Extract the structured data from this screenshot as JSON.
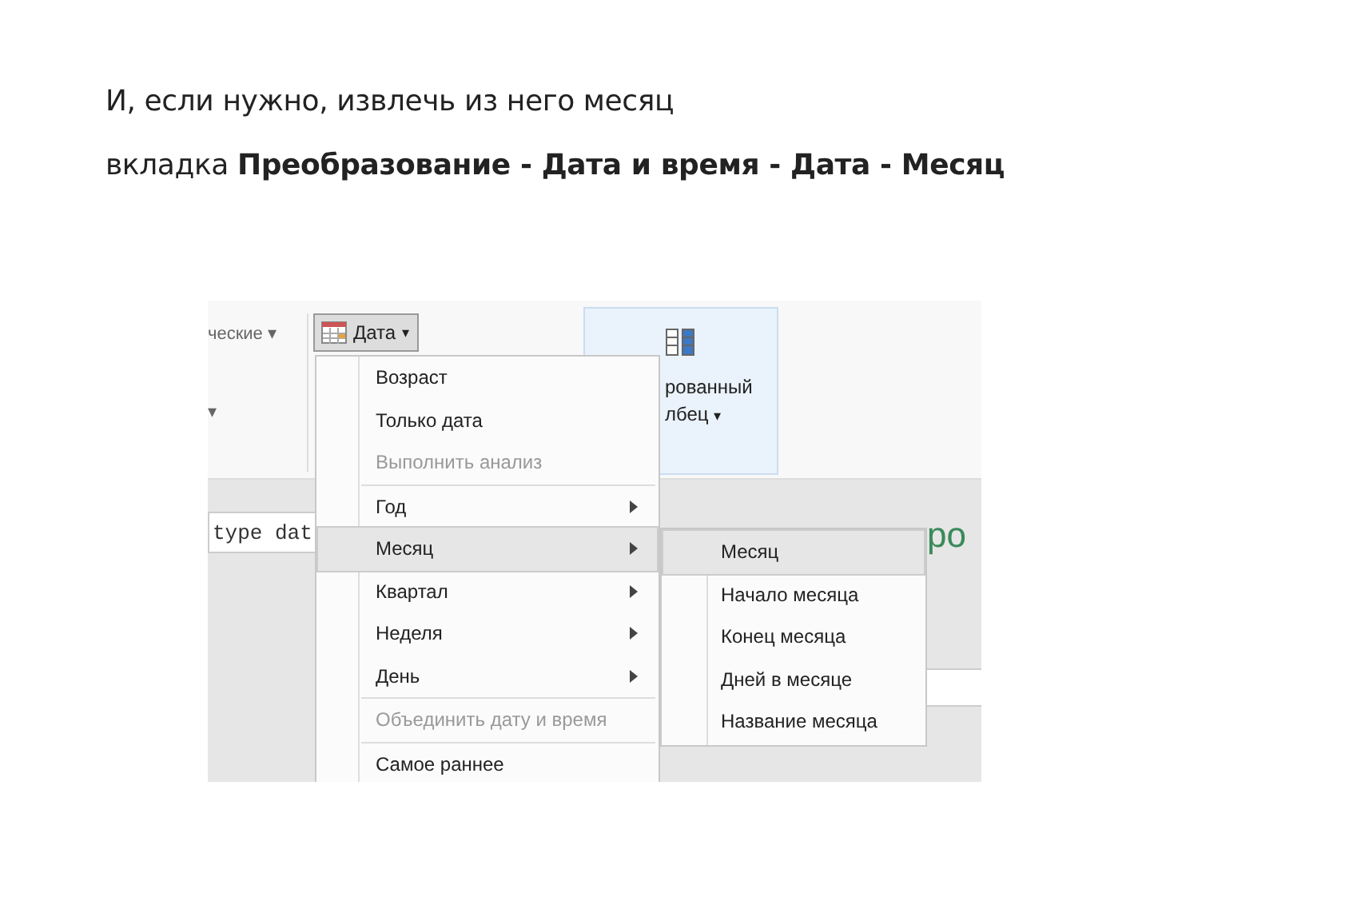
{
  "heading": {
    "line_1": "И, если нужно, извлечь из него месяц",
    "line_2": "вкладка **Преобразование - Дата и время - Дата - Месяц**"
  },
  "screenshot": {
    "ribbon": {
      "group_label": "ческие",
      "group_caret": "▾",
      "lone_caret": "▾",
      "date_button": {
        "label": "Дата",
        "caret": "▾",
        "pressed": true
      },
      "big_button": {
        "line_1": "рованный",
        "line_2": "лбец",
        "caret": "▾"
      }
    },
    "formula_text": "type dat",
    "preview_fragment": "ро",
    "menu": [
      {
        "kind": "item",
        "label": "Возраст",
        "disabled": false,
        "has_submenu": false,
        "selected": false
      },
      {
        "kind": "item",
        "label": "Только дата",
        "disabled": false,
        "has_submenu": false,
        "selected": false
      },
      {
        "kind": "item",
        "label": "Выполнить анализ",
        "disabled": true,
        "has_submenu": false,
        "selected": false
      },
      {
        "kind": "separator"
      },
      {
        "kind": "item",
        "label": "Год",
        "disabled": false,
        "has_submenu": true,
        "selected": false
      },
      {
        "kind": "item",
        "label": "Месяц",
        "disabled": false,
        "has_submenu": true,
        "selected": true
      },
      {
        "kind": "item",
        "label": "Квартал",
        "disabled": false,
        "has_submenu": true,
        "selected": false
      },
      {
        "kind": "item",
        "label": "Неделя",
        "disabled": false,
        "has_submenu": true,
        "selected": false
      },
      {
        "kind": "item",
        "label": "День",
        "disabled": false,
        "has_submenu": true,
        "selected": false
      },
      {
        "kind": "separator"
      },
      {
        "kind": "item",
        "label": "Объединить дату и время",
        "disabled": true,
        "has_submenu": false,
        "selected": false
      },
      {
        "kind": "separator"
      },
      {
        "kind": "item",
        "label": "Самое раннее",
        "disabled": false,
        "has_submenu": false,
        "selected": false
      }
    ],
    "submenu": [
      {
        "label": "Месяц",
        "selected": true
      },
      {
        "label": "Начало месяца",
        "selected": false
      },
      {
        "label": "Конец месяца",
        "selected": false
      },
      {
        "label": "Дней в месяце",
        "selected": false
      },
      {
        "label": "Название месяца",
        "selected": false
      }
    ]
  }
}
